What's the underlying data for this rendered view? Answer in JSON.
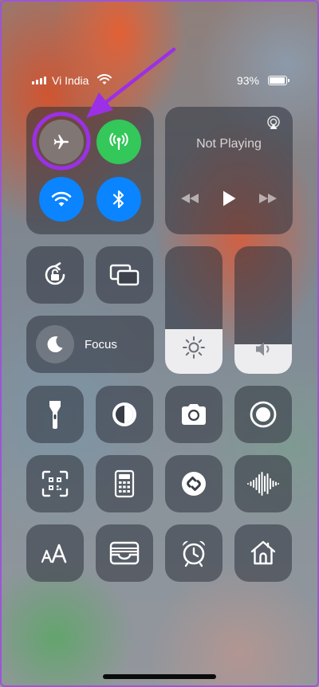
{
  "status_bar": {
    "carrier": "Vi India",
    "battery_percent": "93%",
    "battery_level": 0.93
  },
  "connectivity": {
    "airplane_mode": {
      "icon": "airplane-icon",
      "state": "off",
      "highlighted": true
    },
    "cellular_data": {
      "icon": "antenna-icon",
      "state": "on",
      "color": "#34c759"
    },
    "wifi": {
      "icon": "wifi-icon",
      "state": "on",
      "color": "#0a84ff"
    },
    "bluetooth": {
      "icon": "bluetooth-icon",
      "state": "on",
      "color": "#0a84ff"
    }
  },
  "now_playing": {
    "title": "Not Playing",
    "icons": [
      "airplay-icon",
      "rewind-icon",
      "play-icon",
      "fast-forward-icon"
    ]
  },
  "brightness": {
    "level": 0.35,
    "icon": "sun-icon"
  },
  "volume": {
    "level": 0.23,
    "icon": "speaker-icon"
  },
  "focus": {
    "label": "Focus",
    "icon": "moon-icon"
  },
  "tiles": [
    "orientation-lock-icon",
    "screen-mirroring-icon",
    "flashlight-icon",
    "dark-mode-icon",
    "camera-icon",
    "screen-record-icon",
    "qr-scanner-icon",
    "calculator-icon",
    "shazam-icon",
    "voice-memo-icon",
    "text-size-icon",
    "wallet-icon",
    "alarm-icon",
    "home-icon"
  ],
  "colors": {
    "annotation": "#9b30e6",
    "green": "#34c759",
    "blue": "#0a84ff"
  }
}
